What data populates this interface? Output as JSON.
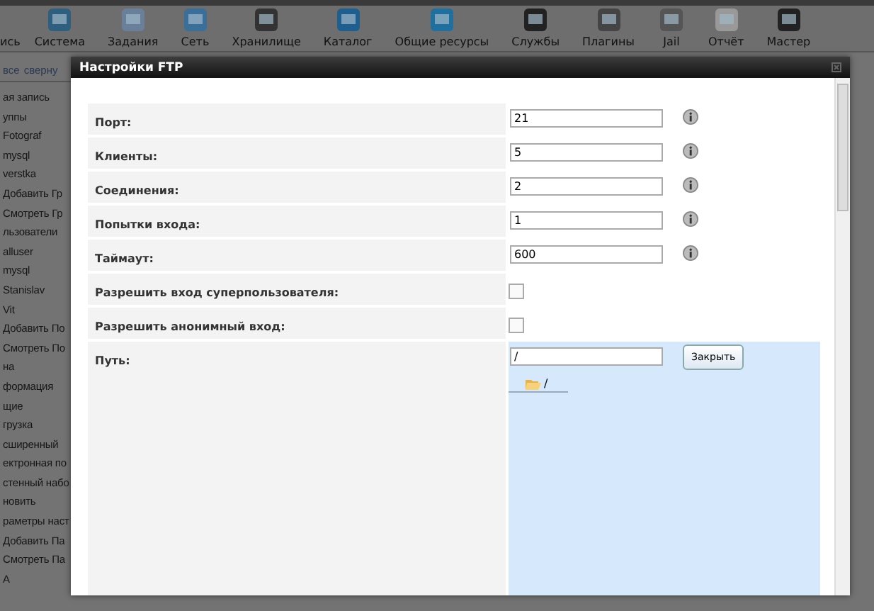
{
  "toolbar": [
    {
      "label": "ись"
    },
    {
      "label": "Система"
    },
    {
      "label": "Задания"
    },
    {
      "label": "Сеть"
    },
    {
      "label": "Хранилище"
    },
    {
      "label": "Каталог"
    },
    {
      "label": "Общие ресурсы"
    },
    {
      "label": "Службы"
    },
    {
      "label": "Плагины"
    },
    {
      "label": "Jail"
    },
    {
      "label": "Отчёт"
    },
    {
      "label": "Мастер"
    }
  ],
  "sidebar": {
    "header": [
      "все",
      "сверну"
    ],
    "items": [
      "ая запись",
      "уппы",
      "Fotograf",
      "mysql",
      "verstka",
      "Добавить Гр",
      "Смотреть Гр",
      "льзователи",
      "alluser",
      "mysql",
      "Stanislav",
      "Vit",
      "Добавить По",
      "Смотреть По",
      "на",
      "формация",
      "щие",
      "грузка",
      "сширенный",
      "ектронная по",
      "стенный набо",
      "новить",
      "раметры наст",
      "Добавить Па",
      "Смотреть Па",
      "А"
    ]
  },
  "dialog": {
    "title": "Настройки FTP",
    "fields": [
      {
        "kind": "text",
        "label": "Порт:",
        "value": "21"
      },
      {
        "kind": "text",
        "label": "Клиенты:",
        "value": "5"
      },
      {
        "kind": "text",
        "label": "Соединения:",
        "value": "2"
      },
      {
        "kind": "text",
        "label": "Попытки входа:",
        "value": "1"
      },
      {
        "kind": "text",
        "label": "Таймаут:",
        "value": "600"
      },
      {
        "kind": "checkbox",
        "label": "Разрешить вход суперпользователя:",
        "checked": false
      },
      {
        "kind": "checkbox",
        "label": "Разрешить анонимный вход:",
        "checked": false
      },
      {
        "kind": "path",
        "label": "Путь:",
        "value": "/",
        "button": "Закрыть",
        "tree_item": "/"
      }
    ]
  }
}
